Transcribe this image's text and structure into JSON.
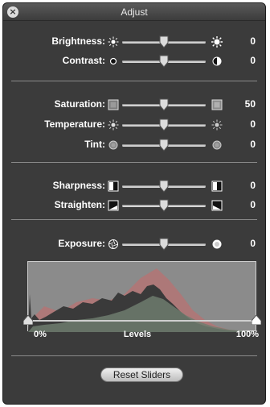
{
  "window": {
    "title": "Adjust"
  },
  "groups": [
    {
      "sliders": [
        {
          "label": "Brightness:",
          "value": "0",
          "position": 0.5,
          "icon_left": "sun-small-icon",
          "icon_right": "sun-large-icon"
        },
        {
          "label": "Contrast:",
          "value": "0",
          "position": 0.5,
          "icon_left": "dot-icon",
          "icon_right": "half-circle-icon"
        }
      ]
    },
    {
      "sliders": [
        {
          "label": "Saturation:",
          "value": "50",
          "position": 0.5,
          "icon_left": "gray-square-icon",
          "icon_right": "color-square-icon"
        },
        {
          "label": "Temperature:",
          "value": "0",
          "position": 0.5,
          "icon_left": "sun-cool-icon",
          "icon_right": "sun-warm-icon"
        },
        {
          "label": "Tint:",
          "value": "0",
          "position": 0.5,
          "icon_left": "tint-circle-left-icon",
          "icon_right": "tint-circle-right-icon"
        }
      ]
    },
    {
      "sliders": [
        {
          "label": "Sharpness:",
          "value": "0",
          "position": 0.5,
          "icon_left": "sharpness-low-icon",
          "icon_right": "sharpness-high-icon"
        },
        {
          "label": "Straighten:",
          "value": "0",
          "position": 0.5,
          "icon_left": "straighten-left-icon",
          "icon_right": "straighten-right-icon"
        }
      ]
    },
    {
      "sliders": [
        {
          "label": "Exposure:",
          "value": "0",
          "position": 0.5,
          "icon_left": "aperture-icon",
          "icon_right": "exposure-circle-icon"
        }
      ]
    }
  ],
  "levels": {
    "label": "Levels",
    "min_label": "0%",
    "max_label": "100%",
    "low": 0,
    "high": 1
  },
  "reset_label": "Reset Sliders",
  "colors": {
    "panel": "#3b3b3b",
    "histogram": "#8b8b8b",
    "text": "#ffffff"
  }
}
